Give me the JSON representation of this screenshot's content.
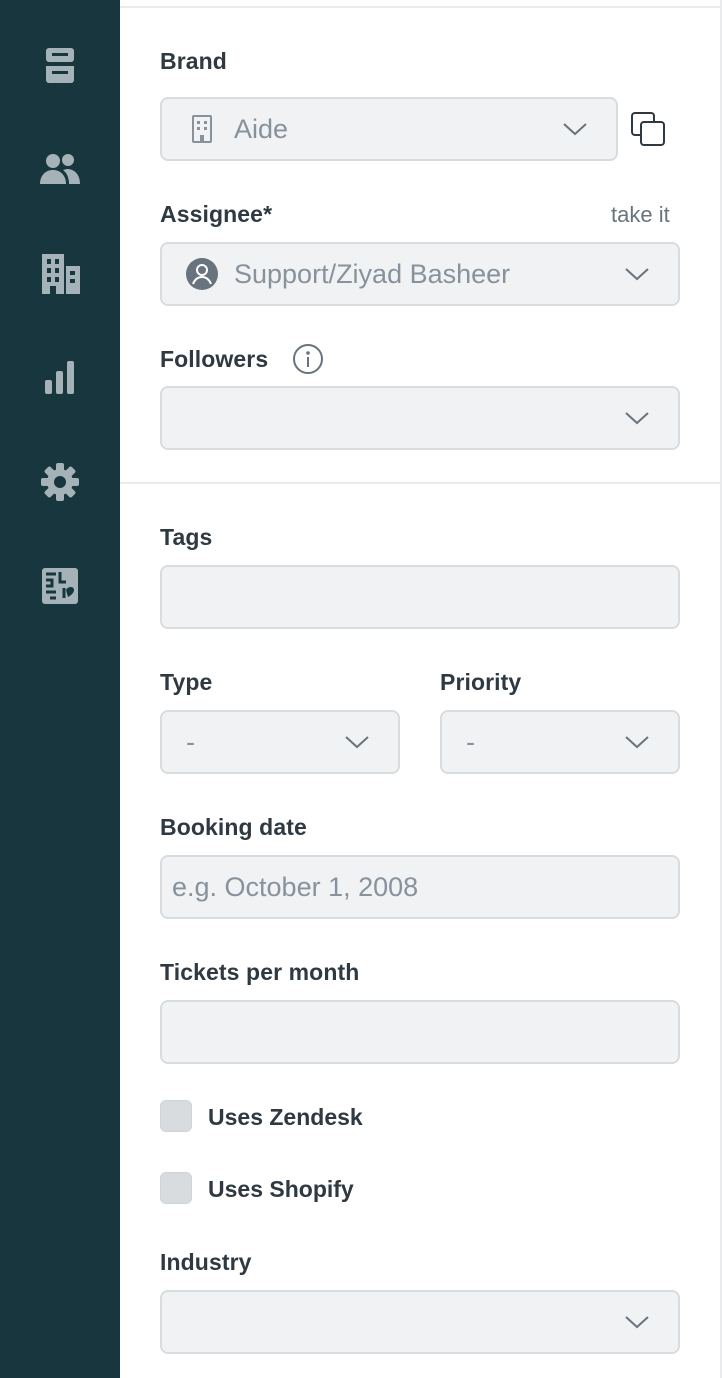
{
  "sidebar": {
    "items": [
      {
        "icon": "inbox-icon"
      },
      {
        "icon": "users-icon"
      },
      {
        "icon": "organizations-icon"
      },
      {
        "icon": "reporting-icon"
      },
      {
        "icon": "settings-icon"
      },
      {
        "icon": "apps-icon"
      }
    ],
    "bg_color": "#17363e",
    "icon_color": "#a5b3b8"
  },
  "form": {
    "brand": {
      "label": "Brand",
      "value": "Aide"
    },
    "assignee": {
      "label": "Assignee*",
      "take_it": "take it",
      "value": "Support/Ziyad Basheer"
    },
    "followers": {
      "label": "Followers",
      "value": ""
    },
    "tags": {
      "label": "Tags",
      "value": ""
    },
    "type": {
      "label": "Type",
      "value": "-"
    },
    "priority": {
      "label": "Priority",
      "value": "-"
    },
    "booking_date": {
      "label": "Booking date",
      "placeholder": "e.g. October 1, 2008"
    },
    "tickets_per_month": {
      "label": "Tickets per month",
      "value": ""
    },
    "uses_zendesk": {
      "label": "Uses Zendesk",
      "checked": false
    },
    "uses_shopify": {
      "label": "Uses Shopify",
      "checked": false
    },
    "industry": {
      "label": "Industry",
      "value": ""
    }
  },
  "colors": {
    "field_bg": "#f1f2f3",
    "field_border": "#d8dcde",
    "label_text": "#2f3941",
    "muted_text": "#87929d"
  }
}
